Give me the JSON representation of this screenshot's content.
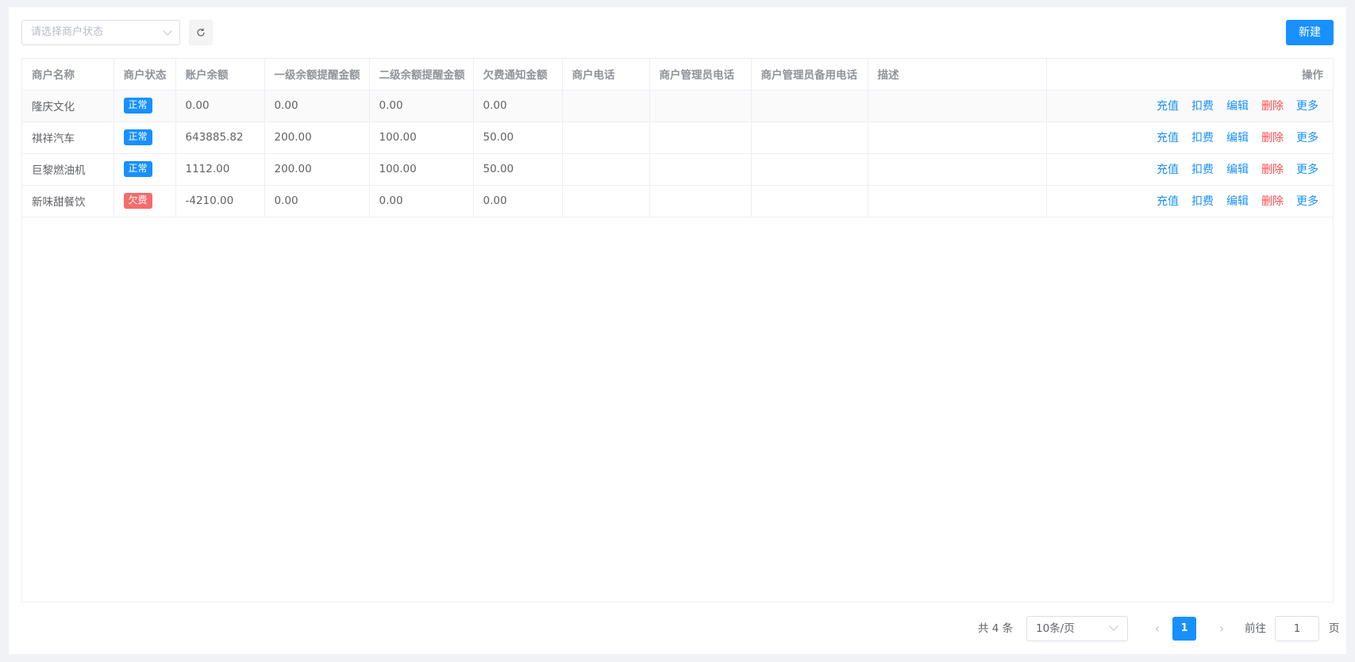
{
  "toolbar": {
    "status_placeholder": "请选择商户状态",
    "refresh_icon": "refresh-icon",
    "new_label": "新建"
  },
  "table": {
    "columns": [
      "商户名称",
      "商户状态",
      "账户余额",
      "一级余额提醒金额",
      "二级余额提醒金额",
      "欠费通知金额",
      "商户电话",
      "商户管理员电话",
      "商户管理员备用电话",
      "描述",
      "操作"
    ],
    "rows": [
      {
        "name": "隆庆文化",
        "status": "正常",
        "status_color": "#1890ff",
        "balance": "0.00",
        "level1": "0.00",
        "level2": "0.00",
        "arrears": "0.00",
        "phone": "",
        "admin_phone": "",
        "admin_backup_phone": "",
        "desc": ""
      },
      {
        "name": "祺祥汽车",
        "status": "正常",
        "status_color": "#1890ff",
        "balance": "643885.82",
        "level1": "200.00",
        "level2": "100.00",
        "arrears": "50.00",
        "phone": "",
        "admin_phone": "",
        "admin_backup_phone": "",
        "desc": ""
      },
      {
        "name": "巨黎燃油机",
        "status": "正常",
        "status_color": "#1890ff",
        "balance": "1112.00",
        "level1": "200.00",
        "level2": "100.00",
        "arrears": "50.00",
        "phone": "",
        "admin_phone": "",
        "admin_backup_phone": "",
        "desc": ""
      },
      {
        "name": "新味甜餐饮",
        "status": "欠费",
        "status_color": "#f56c6c",
        "balance": "-4210.00",
        "level1": "0.00",
        "level2": "0.00",
        "arrears": "0.00",
        "phone": "",
        "admin_phone": "",
        "admin_backup_phone": "",
        "desc": ""
      }
    ],
    "actions": [
      {
        "label": "充值",
        "color": "#1890ff"
      },
      {
        "label": "扣费",
        "color": "#1890ff"
      },
      {
        "label": "编辑",
        "color": "#1890ff"
      },
      {
        "label": "删除",
        "color": "#ff4d4f"
      },
      {
        "label": "更多",
        "color": "#1890ff"
      }
    ]
  },
  "pagination": {
    "total_label": "共 4 条",
    "page_size": "10条/页",
    "current_page": "1",
    "goto_label": "前往",
    "goto_value": "1",
    "goto_suffix": "页",
    "prev_icon": "chevron-left-icon",
    "next_icon": "chevron-right-icon"
  },
  "colors": {
    "primary": "#1890ff",
    "danger": "#ff4d4f",
    "arrears_tag": "#f56c6c"
  }
}
